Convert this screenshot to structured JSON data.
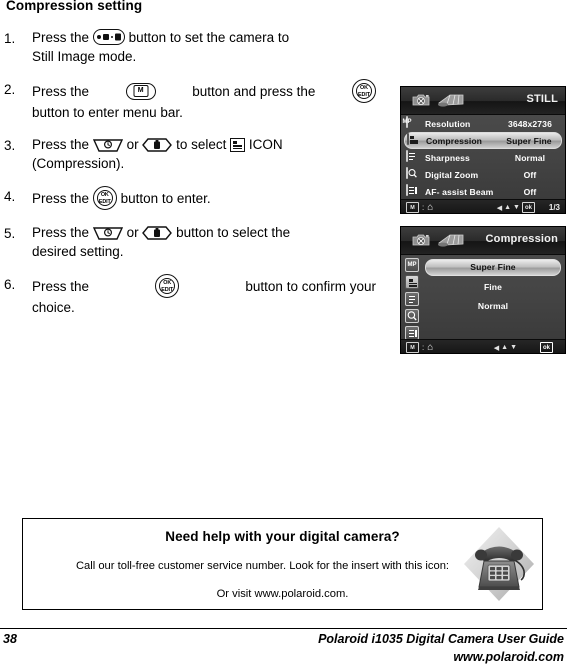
{
  "page": {
    "heading": "Compression setting",
    "number": "38",
    "footer_guide": "Polaroid i1035 Digital Camera User Guide",
    "footer_url": "www.polaroid.com"
  },
  "steps": [
    {
      "num": "1.",
      "parts": [
        "Press the",
        "button to set the camera to",
        "Still Image mode."
      ],
      "icon": "mode-button-icon"
    },
    {
      "num": "2.",
      "parts": [
        "Press the",
        "button and press the",
        "button to enter menu bar."
      ],
      "icon": "menu-button-icon"
    },
    {
      "num": "3.",
      "parts": [
        "Press the",
        "or",
        "to select",
        "ICON",
        "(Compression)."
      ],
      "icon": "up-down-buttons-icon"
    },
    {
      "num": "4.",
      "parts": [
        "Press the",
        "button to enter."
      ],
      "icon": "ok-edit-button-icon"
    },
    {
      "num": "5.",
      "parts": [
        "Press the",
        "or",
        "button to select the",
        "desired setting."
      ],
      "icon": "up-down-buttons-icon"
    },
    {
      "num": "6.",
      "parts": [
        "Press the",
        "button to confirm your",
        "choice."
      ],
      "icon": "ok-edit-button-icon"
    }
  ],
  "button_labels": {
    "menu_m": "M",
    "ok": "OK",
    "edit": "EDIT"
  },
  "lcd_still": {
    "title": "STILL",
    "rows": [
      {
        "icon": "resolution-icon",
        "icon_text": "MP",
        "label": "Resolution",
        "value": "3648x2736",
        "selected": false
      },
      {
        "icon": "compression-icon",
        "icon_text": "",
        "label": "Compression",
        "value": "Super Fine",
        "selected": true
      },
      {
        "icon": "sharpness-icon",
        "icon_text": "",
        "label": "Sharpness",
        "value": "Normal",
        "selected": false
      },
      {
        "icon": "digital-zoom-icon",
        "icon_text": "",
        "label": "Digital Zoom",
        "value": "Off",
        "selected": false
      },
      {
        "icon": "af-assist-icon",
        "icon_text": "",
        "label": "AF- assist Beam",
        "value": "Off",
        "selected": false
      }
    ],
    "status": {
      "mode_box": "M",
      "colon": ":",
      "home": "⌂",
      "nav_left": "◀",
      "nav_up": "▲",
      "nav_down": "▼",
      "ok": "ok",
      "page": "1/3"
    }
  },
  "lcd_compression": {
    "title": "Compression",
    "side_icons": [
      "resolution-icon",
      "compression-icon",
      "sharpness-icon",
      "digital-zoom-icon",
      "af-assist-icon"
    ],
    "side_icon_text": [
      "MP",
      "",
      "",
      "",
      ""
    ],
    "options": [
      {
        "label": "Super Fine",
        "selected": true
      },
      {
        "label": "Fine",
        "selected": false
      },
      {
        "label": "Normal",
        "selected": false
      }
    ],
    "status": {
      "mode_box": "M",
      "colon": ":",
      "home": "⌂",
      "nav_left": "◀",
      "nav_up": "▲",
      "nav_down": "▼",
      "ok": "ok"
    }
  },
  "help_box": {
    "title": "Need help with your digital camera?",
    "line1": "Call our toll-free customer service number. Look for the insert with this icon:",
    "line2": "Or visit www.polaroid.com."
  },
  "colors": {
    "lcd_bg": "#3f3f3f",
    "lcd_header": "#262626",
    "selected_row": "#c8c8c8",
    "text_light": "#ffffff",
    "page_text": "#000000"
  }
}
